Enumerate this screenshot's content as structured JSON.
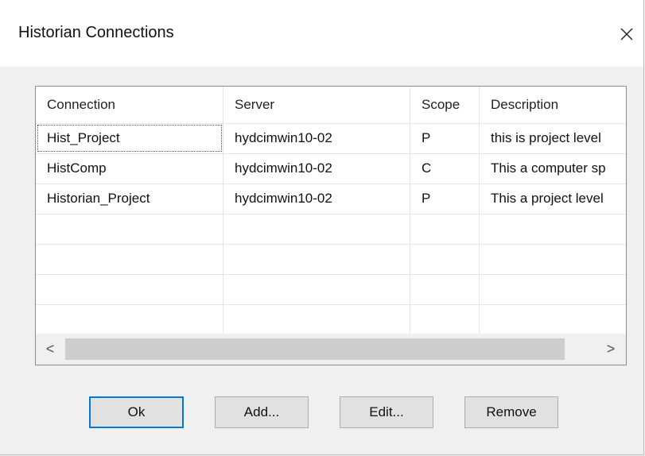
{
  "window": {
    "title": "Historian Connections",
    "close_glyph": "×"
  },
  "table": {
    "columns": [
      "Connection",
      "Server",
      "Scope",
      "Description"
    ],
    "rows": [
      {
        "connection": "Hist_Project",
        "server": "hydcimwin10-02",
        "scope": "P",
        "description": "this is project level"
      },
      {
        "connection": "HistComp",
        "server": "hydcimwin10-02",
        "scope": "C",
        "description": "This a computer sp"
      },
      {
        "connection": "Historian_Project",
        "server": "hydcimwin10-02",
        "scope": "P",
        "description": "This a project level"
      }
    ]
  },
  "scrollbar": {
    "left_arrow": "<",
    "right_arrow": ">"
  },
  "buttons": {
    "ok": "Ok",
    "add": "Add...",
    "edit": "Edit...",
    "remove": "Remove"
  }
}
